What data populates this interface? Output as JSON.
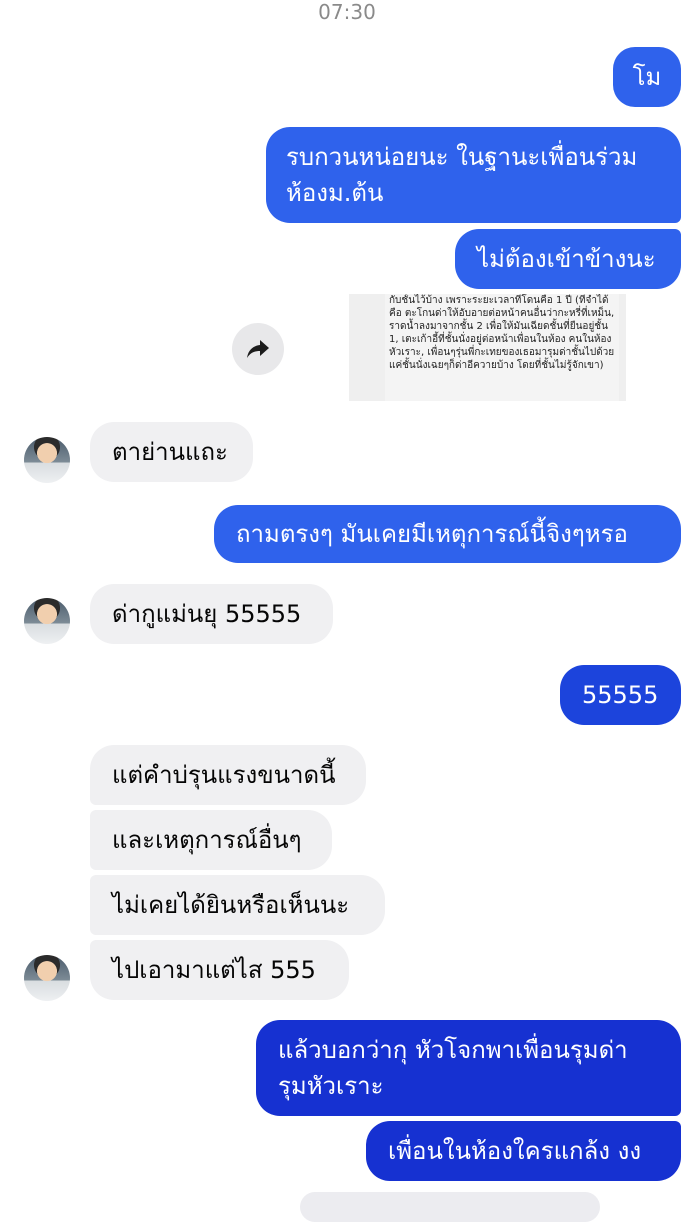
{
  "status_bar": {
    "time": "07:30"
  },
  "messages": [
    {
      "id": "m1",
      "side": "out",
      "text": "โม"
    },
    {
      "id": "m2",
      "side": "out",
      "lines": [
        "รบกวนหน่อยนะ ในฐานะเพื่อนร่วม",
        "ห้องม.ต้น"
      ]
    },
    {
      "id": "m3",
      "side": "out",
      "text": "ไม่ต้องเข้าข้างนะ"
    },
    {
      "id": "m4",
      "side": "out",
      "type": "image",
      "text": "กับชั้นไว้บ้าง เพราะระยะเวลาที่โดนคือ 1 ปี (ที่จำได้คือ ตะโกนด่าให้อับอายต่อหน้าคนอื่นว่ากะหรี่ที่เหม็น, ราดน้ำลงมาจากชั้น 2 เพื่อให้มันเฉียดชั้นที่ยืนอยู่ชั้น 1, เตะเก้าอี้ที่ชั้นนั่งอยู่ต่อหน้าเพื่อนในห้อง คนในห้องหัวเราะ, เพื่อนๆรุ่นพี่กะเทยของเธอมารุมด่าชั้นไปด้วย แค่ชั้นนั่งเฉยๆก็ด่าอีควายบ้าง โดยที่ชั้นไม่รู้จักเขา)"
    },
    {
      "id": "m5",
      "side": "in",
      "text": "ตาย่านแถะ"
    },
    {
      "id": "m6",
      "side": "out",
      "text": "ถามตรงๆ มันเคยมีเหตุการณ์นี้จิงๆหรอ"
    },
    {
      "id": "m7",
      "side": "in",
      "text": "ด่ากูแม่นยุ 55555"
    },
    {
      "id": "m8",
      "side": "out",
      "text": "55555"
    },
    {
      "id": "m9",
      "side": "in",
      "text": "แต่คำบ่รุนแรงขนาดนี้"
    },
    {
      "id": "m10",
      "side": "in",
      "text": "และเหตุการณ์อื่นๆ"
    },
    {
      "id": "m11",
      "side": "in",
      "text": "ไม่เคยได้ยินหรือเห็นนะ"
    },
    {
      "id": "m12",
      "side": "in",
      "text": "ไปเอามาแต่ไส 555"
    },
    {
      "id": "m13",
      "side": "out",
      "lines": [
        "แล้วบอกว่ากุ หัวโจกพาเพื่อนรุมด่า",
        "รุมหัวเราะ"
      ]
    },
    {
      "id": "m14",
      "side": "out",
      "text": "เพื่อนในห้องใครแกล้ง งง"
    }
  ],
  "colors": {
    "outgoing_top": "#2f62ec",
    "outgoing_mid": "#1c44dc",
    "outgoing_bottom": "#1631d1",
    "incoming": "#f0f0f2"
  },
  "icons": {
    "forward": "share-arrow-icon",
    "avatar": "contact-avatar"
  }
}
